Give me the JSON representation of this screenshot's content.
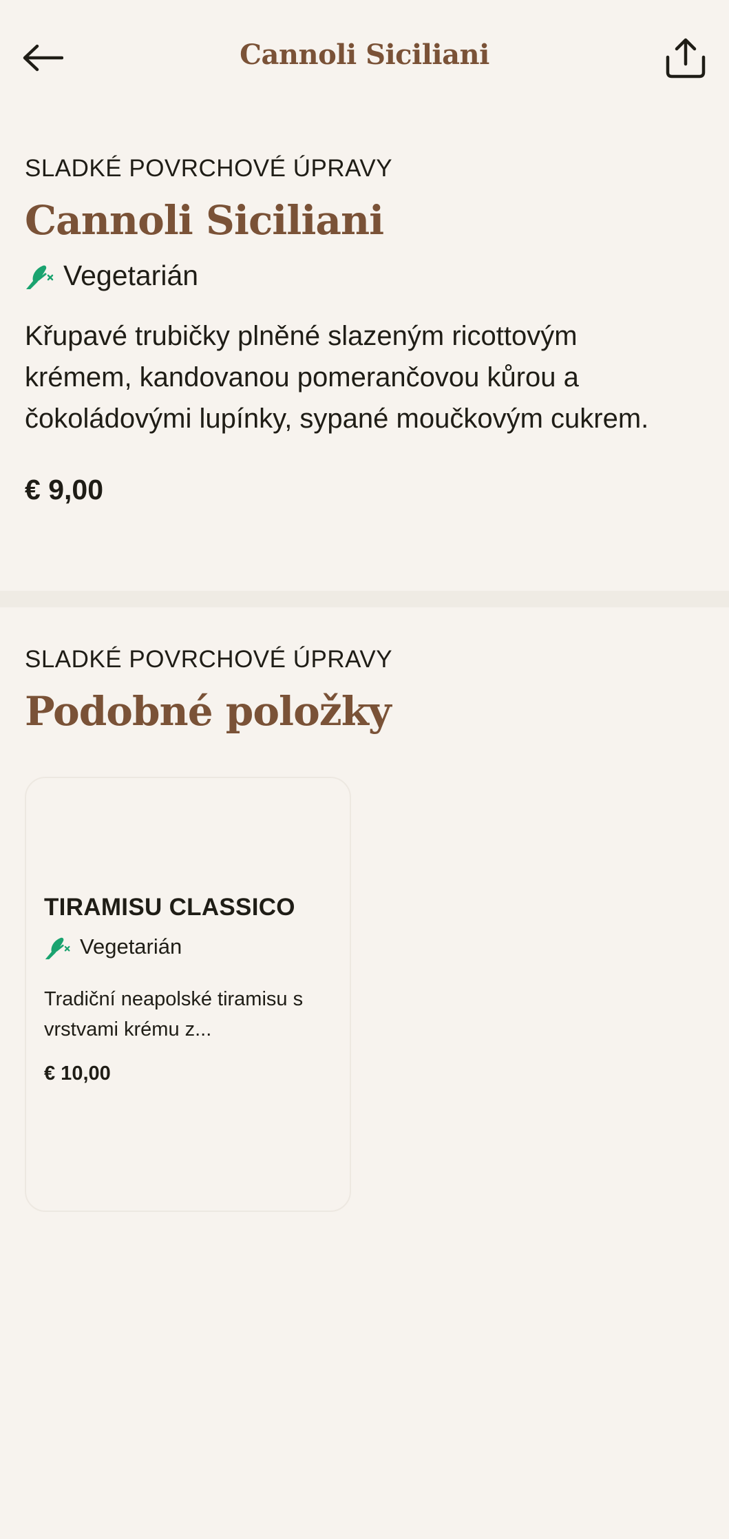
{
  "header": {
    "title": "Cannoli Siciliani",
    "back_icon": "arrow-left-icon",
    "share_icon": "share-icon"
  },
  "item": {
    "category": "SLADKÉ POVRCHOVÉ ÚPRAVY",
    "name": "Cannoli Siciliani",
    "diet_label": "Vegetarián",
    "diet_icon": "vegetarian-icon",
    "description": "Křupavé trubičky plněné slazeným ricottovým krémem, kandovanou pomerančovou kůrou a čokoládovými lupínky, sypané moučkovým cukrem.",
    "price": "€ 9,00"
  },
  "similar": {
    "category": "SLADKÉ POVRCHOVÉ ÚPRAVY",
    "title": "Podobné položky",
    "items": [
      {
        "name": "TIRAMISU CLASSICO",
        "diet_label": "Vegetarián",
        "description": "Tradiční neapolské tiramisu s vrstvami krému z...",
        "price": "€ 10,00"
      }
    ]
  },
  "colors": {
    "background": "#f7f3ee",
    "accent_brown": "#7a5237",
    "text": "#1f1d16",
    "veg_green": "#1aa36f",
    "divider": "#efebe4"
  }
}
